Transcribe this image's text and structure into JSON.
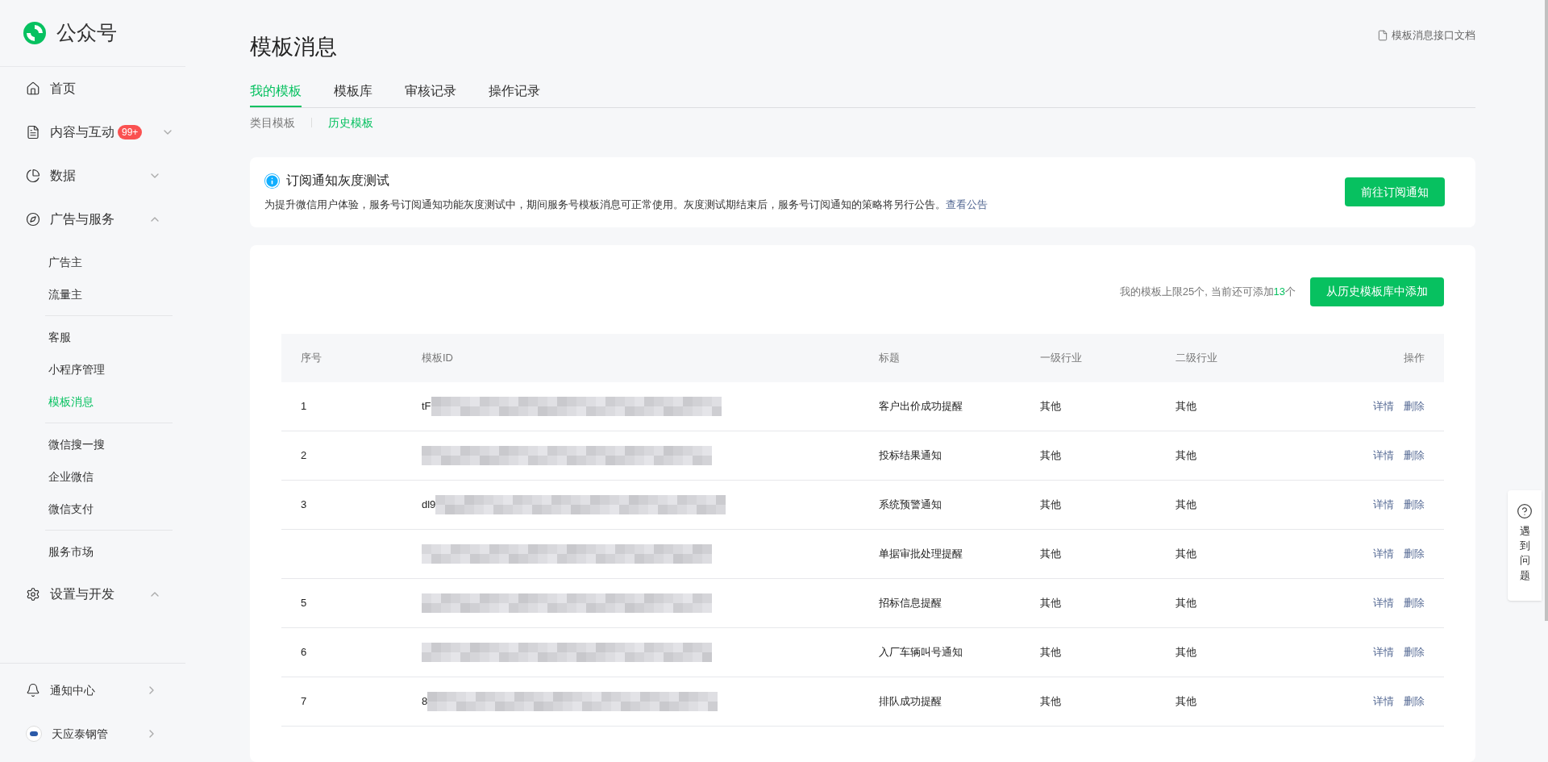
{
  "sidebar": {
    "logo_text": "公众号",
    "menu": [
      {
        "label": "首页",
        "kind": "link"
      },
      {
        "label": "内容与互动",
        "kind": "group",
        "badge": "99+",
        "expanded": false
      },
      {
        "label": "数据",
        "kind": "group",
        "expanded": false
      },
      {
        "label": "广告与服务",
        "kind": "group",
        "expanded": true,
        "sections": [
          [
            {
              "label": "广告主",
              "selected": false
            },
            {
              "label": "流量主",
              "selected": false
            }
          ],
          [
            {
              "label": "客服",
              "selected": false
            },
            {
              "label": "小程序管理",
              "selected": false
            },
            {
              "label": "模板消息",
              "selected": true
            }
          ],
          [
            {
              "label": "微信搜一搜",
              "selected": false
            },
            {
              "label": "企业微信",
              "selected": false
            },
            {
              "label": "微信支付",
              "selected": false
            }
          ],
          [
            {
              "label": "服务市场",
              "selected": false
            }
          ]
        ]
      },
      {
        "label": "设置与开发",
        "kind": "group",
        "expanded": true
      }
    ],
    "footer": [
      {
        "label": "通知中心",
        "kind": "bell"
      },
      {
        "label": "天应泰钢管",
        "kind": "account"
      }
    ]
  },
  "page": {
    "title": "模板消息",
    "docs_link": "模板消息接口文档",
    "tabs": [
      {
        "label": "我的模板",
        "selected": true
      },
      {
        "label": "模板库",
        "selected": false
      },
      {
        "label": "审核记录",
        "selected": false
      },
      {
        "label": "操作记录",
        "selected": false
      }
    ],
    "subtabs": [
      {
        "label": "类目模板",
        "selected": false
      },
      {
        "label": "历史模板",
        "selected": true
      }
    ]
  },
  "notice": {
    "title": "订阅通知灰度测试",
    "text": "为提升微信用户体验，服务号订阅通知功能灰度测试中，期间服务号模板消息可正常使用。灰度测试期结束后，服务号订阅通知的策略将另行公告。",
    "link": "查看公告",
    "button": "前往订阅通知"
  },
  "table": {
    "quota_text": "我的模板上限25个, 当前还可添加",
    "quota_count": "13",
    "quota_unit": "个",
    "add_button": "从历史模板库中添加",
    "columns": [
      "序号",
      "模板ID",
      "标题",
      "一级行业",
      "二级行业",
      "操作"
    ],
    "rows": [
      {
        "index": "1",
        "id_prefix": "tF",
        "title": "客户出价成功提醒",
        "industry_1": "其他",
        "industry_2": "其他",
        "actions": [
          "详情",
          "删除"
        ]
      },
      {
        "index": "2",
        "title": "投标结果通知",
        "industry_1": "其他",
        "industry_2": "其他",
        "actions": [
          "详情",
          "删除"
        ]
      },
      {
        "index": "3",
        "id_prefix": "dl9",
        "title": "系统预警通知",
        "industry_1": "其他",
        "industry_2": "其他",
        "actions": [
          "详情",
          "删除"
        ]
      },
      {
        "title": "单据审批处理提醒",
        "industry_1": "其他",
        "industry_2": "其他",
        "actions": [
          "详情",
          "删除"
        ]
      },
      {
        "index": "5",
        "title": "招标信息提醒",
        "industry_1": "其他",
        "industry_2": "其他",
        "actions": [
          "详情",
          "删除"
        ]
      },
      {
        "index": "6",
        "title": "入厂车辆叫号通知",
        "industry_1": "其他",
        "industry_2": "其他",
        "actions": [
          "详情",
          "删除"
        ]
      },
      {
        "index": "7",
        "id_prefix": "8",
        "title": "排队成功提醒",
        "industry_1": "其他",
        "industry_2": "其他",
        "actions": [
          "详情",
          "删除"
        ]
      }
    ]
  },
  "help": {
    "label": "遇到问题"
  }
}
